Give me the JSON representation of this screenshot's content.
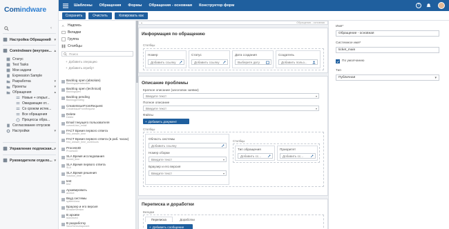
{
  "brand": {
    "logo_main": "Com",
    "logo_rest": "indware"
  },
  "topbar": {
    "breadcrumbs": [
      "Шаблоны",
      "Обращения",
      "Формы",
      "Обращения - основная",
      "Конструктор форм"
    ],
    "accent": "#1f5f9e"
  },
  "actions": {
    "save": "Сохранить",
    "clear": "Очистить",
    "copy": "Копировать как"
  },
  "sidebar": {
    "items": [
      {
        "label": "Настройка Обращений",
        "icon": "settings-icon"
      },
      {
        "label": "Comindware (внутрен...",
        "icon": "app-icon"
      },
      {
        "label": "Статус",
        "icon": "status-icon"
      },
      {
        "label": "Test Tasks",
        "icon": "task-icon"
      },
      {
        "label": "Мои задачи",
        "icon": "task-icon"
      },
      {
        "label": "Expression Sample",
        "icon": "doc-icon"
      },
      {
        "label": "Разработка",
        "icon": "folder-icon"
      },
      {
        "label": "Проекты",
        "icon": "folder-icon"
      },
      {
        "label": "Обращения",
        "icon": "folder-icon"
      },
      {
        "label": "Новые + открыт...",
        "icon": "list-icon"
      },
      {
        "label": "Ожидающие от...",
        "icon": "list-icon"
      },
      {
        "label": "Со сроком истек...",
        "icon": "list-icon"
      },
      {
        "label": "Все обращения",
        "icon": "list-icon"
      },
      {
        "label": "Процессы обра...",
        "icon": "process-icon"
      },
      {
        "label": "Согласование отпусков",
        "icon": "doc-icon"
      },
      {
        "label": "Настройки",
        "icon": "gear-icon"
      },
      {
        "label": "Управление подпиская...",
        "icon": "app-icon"
      },
      {
        "label": "Руководители отдело...",
        "icon": "app-icon"
      }
    ]
  },
  "toolbox": {
    "widgets": [
      "Надпись",
      "Вкладки",
      "Группа",
      "Столбцы"
    ],
    "search_placeholder": "Поиск",
    "add_attribute": "Добавить атрибут",
    "add_operation": "Добавить операцию",
    "fields": [
      {
        "name": "Backlog open (absolute)",
        "sys": "Backlogopenabsolute"
      },
      {
        "name": "Backlog open (technical)",
        "sys": "Backlogopen"
      },
      {
        "name": "Backlog pending",
        "sys": "Backlogpending"
      },
      {
        "name": "CreateIssueFromRequest",
        "sys": "CreateIssueFromRequest"
      },
      {
        "name": "Delete",
        "sys": "Delete"
      },
      {
        "name": "Email текущего пользователя",
        "sys": "currentUser_email"
      },
      {
        "name": "FACT Время первого ответа",
        "sys": "first_answer_time"
      },
      {
        "name": "FACT Время первого ответа (в раб. часах)",
        "sys": "first_answer_time_workhours"
      },
      {
        "name": "ProcessID",
        "sys": "ProcessID"
      },
      {
        "name": "SLA Время исследования",
        "sys": "Investi_time"
      },
      {
        "name": "SLA Время первого ответа",
        "sys": "SLA"
      },
      {
        "name": "SLA Время решения",
        "sys": "Solution_time"
      },
      {
        "name": "test",
        "sys": "test"
      },
      {
        "name": "Архивировать",
        "sys": "archive"
      },
      {
        "name": "Вкуд системы",
        "sys": "systemArea"
      },
      {
        "name": "Браузер и его версия",
        "sys": "BrowserVersion"
      },
      {
        "name": "В архиве",
        "sys": "isArchived"
      },
      {
        "name": "В разработку",
        "sys": "SendToDevelopment"
      }
    ]
  },
  "canvas": {
    "header_right": "Обращения - основная",
    "sec1": {
      "title": "Информация по обращению",
      "columns_label": "Столбцы",
      "cols": [
        {
          "label": "Номер",
          "value": "Добавить ссылку"
        },
        {
          "label": "Статус",
          "value": "Добавить ссылку"
        },
        {
          "label": "Дата создания",
          "value": "Выберите дату"
        },
        {
          "label": "Создатель",
          "value": "Добавить польз..."
        }
      ]
    },
    "sec2": {
      "title": "Описание проблемы",
      "short_label": "Краткое описание (заголовок заявки)",
      "short_ph": "Введите текст",
      "full_label": "Полное описание",
      "full_ph": "Введите текст",
      "files_label": "Файлы",
      "add_doc": "Добавить документ",
      "columns_label": "Столбцы",
      "area_label": "Область системы",
      "area_value": "Добавить ссылку",
      "build_label": "Номер сборки",
      "build_ph": "Введите текст",
      "browser_label": "Браузер и его версия",
      "browser_ph": "Введите текст",
      "inner_columns_label": "Столбцы",
      "type_label": "Тип обращения",
      "type_value": "Добавить сс...",
      "prio_label": "Приоритет",
      "prio_value": "Добавить сс..."
    },
    "sec3": {
      "title": "Переписка и доработки",
      "tabs_label": "Вкладки",
      "tabs": [
        "Переписка",
        "Доработки"
      ],
      "add_btn": "Добавить сообщение"
    }
  },
  "props": {
    "name_label": "Имя*",
    "name_value": "Обращение - основная",
    "sys_label": "Системное имя*",
    "sys_value": "ticket_main",
    "default_label": "По умолчанию",
    "default_checked": true,
    "type_label": "Тип",
    "type_value": "Публичная"
  }
}
